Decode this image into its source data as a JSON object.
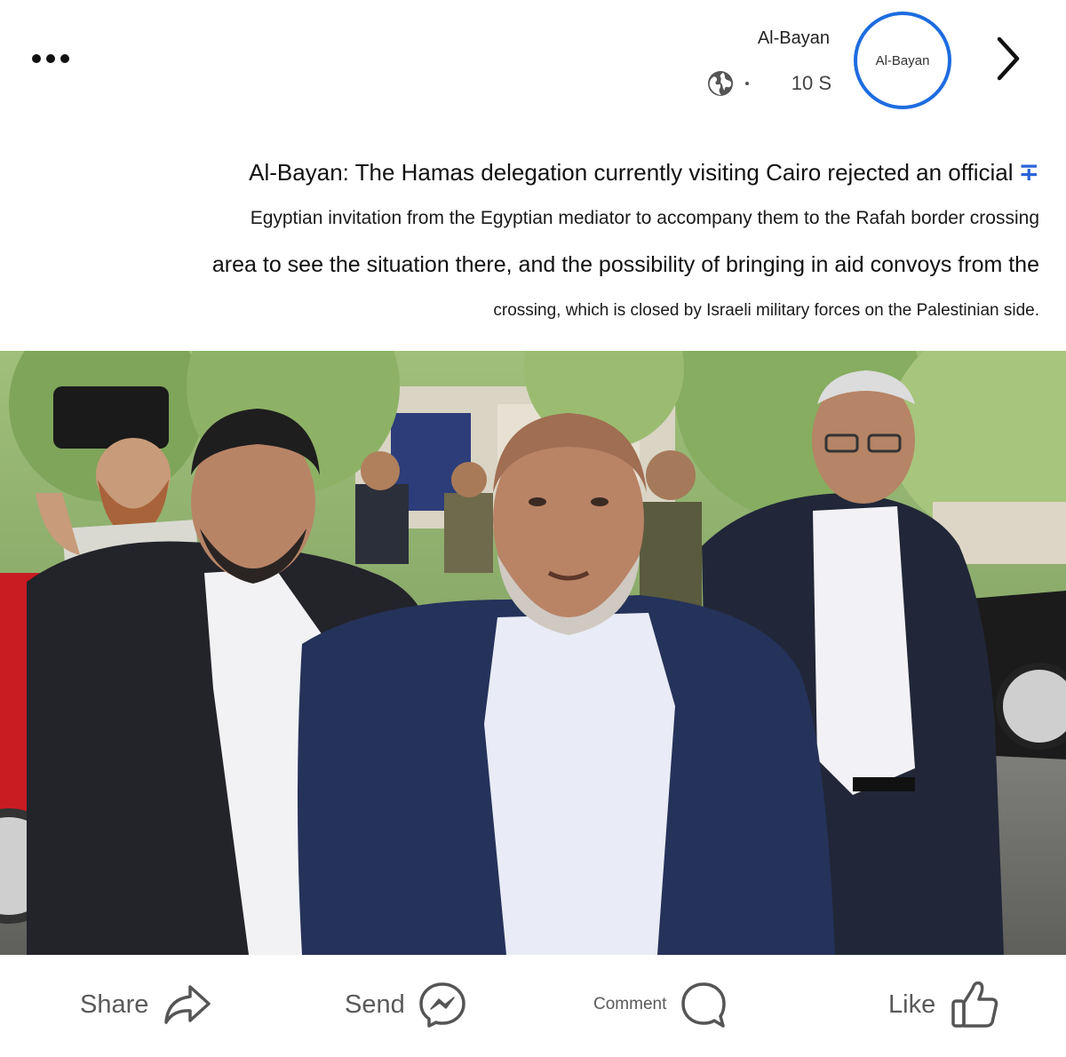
{
  "header": {
    "page_name": "Al-Bayan",
    "time_ago": "10 S",
    "avatar_label": "Al-Bayan",
    "privacy_icon": "globe-icon",
    "more_icon": "more-horizontal-icon",
    "next_icon": "chevron-right-icon",
    "avatar_ring_color": "#1d6ce0"
  },
  "post": {
    "lines": [
      "Al-Bayan: The Hamas delegation currently visiting Cairo rejected an official",
      "Egyptian invitation from the Egyptian mediator to accompany them to the Rafah border crossing",
      "area to see the situation there, and the possibility of bringing in aid convoys from the",
      "crossing, which is closed by Israeli military forces on the Palestinian side."
    ],
    "marker": "∓",
    "marker_color": "#2b63d9"
  },
  "actions": {
    "share_label": "Share",
    "send_label": "Send",
    "comment_label": "Comment",
    "like_label": "Like",
    "share_icon": "share-arrow-icon",
    "send_icon": "messenger-icon",
    "comment_icon": "comment-bubble-icon",
    "like_icon": "thumbs-up-icon"
  }
}
